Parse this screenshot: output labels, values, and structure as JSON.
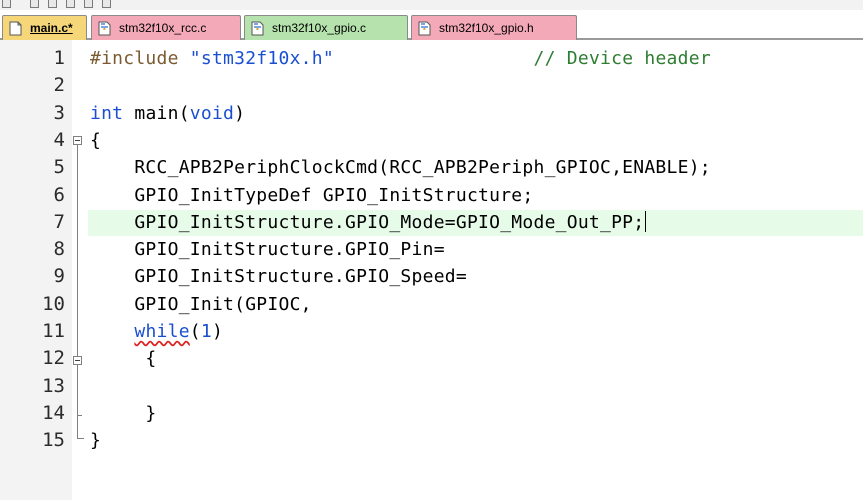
{
  "tabs": [
    {
      "label": "main.c*",
      "active": true,
      "color": "#f5d77a"
    },
    {
      "label": "stm32f10x_rcc.c",
      "active": false,
      "color": "#f3a9b8"
    },
    {
      "label": "stm32f10x_gpio.c",
      "active": false,
      "color": "#b6e3ad"
    },
    {
      "label": "stm32f10x_gpio.h",
      "active": false,
      "color": "#f3a9b8"
    }
  ],
  "editor": {
    "current_line": 7,
    "lines": [
      {
        "num": "1",
        "parts": [
          [
            "pp",
            "#include "
          ],
          [
            "str",
            "\"stm32f10x.h\""
          ],
          [
            "t",
            "                  "
          ],
          [
            "cmt",
            "// Device header"
          ]
        ]
      },
      {
        "num": "2",
        "parts": []
      },
      {
        "num": "3",
        "parts": [
          [
            "kw",
            "int"
          ],
          [
            "t",
            " main("
          ],
          [
            "kw",
            "void"
          ],
          [
            "t",
            ")"
          ]
        ]
      },
      {
        "num": "4",
        "parts": [
          [
            "t",
            "{"
          ]
        ]
      },
      {
        "num": "5",
        "parts": [
          [
            "t",
            "    RCC_APB2PeriphClockCmd(RCC_APB2Periph_GPIOC,ENABLE);"
          ]
        ]
      },
      {
        "num": "6",
        "parts": [
          [
            "t",
            "    GPIO_InitTypeDef GPIO_InitStructure;"
          ]
        ]
      },
      {
        "num": "7",
        "parts": [
          [
            "t",
            "    GPIO_InitStructure.GPIO_Mode=GPIO_Mode_Out_PP;"
          ],
          [
            "caret",
            ""
          ]
        ]
      },
      {
        "num": "8",
        "parts": [
          [
            "t",
            "    GPIO_InitStructure.GPIO_Pin="
          ]
        ]
      },
      {
        "num": "9",
        "parts": [
          [
            "t",
            "    GPIO_InitStructure.GPIO_Speed="
          ]
        ]
      },
      {
        "num": "10",
        "parts": [
          [
            "t",
            "    GPIO_Init(GPIOC,"
          ]
        ]
      },
      {
        "num": "11",
        "parts": [
          [
            "t",
            "    "
          ],
          [
            "kwsq",
            "while"
          ],
          [
            "t",
            "("
          ],
          [
            "num",
            "1"
          ],
          [
            "t",
            ")"
          ]
        ]
      },
      {
        "num": "12",
        "parts": [
          [
            "t",
            "     {"
          ]
        ]
      },
      {
        "num": "13",
        "parts": []
      },
      {
        "num": "14",
        "parts": [
          [
            "t",
            "     }"
          ]
        ]
      },
      {
        "num": "15",
        "parts": [
          [
            "t",
            "}"
          ]
        ]
      }
    ]
  }
}
